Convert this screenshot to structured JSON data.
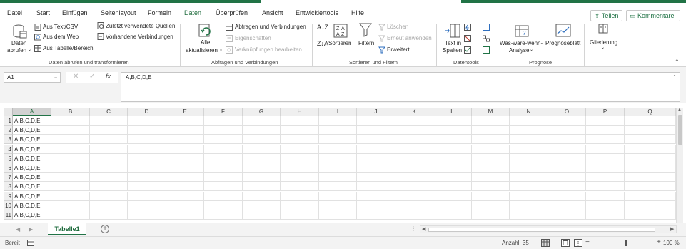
{
  "app": {
    "accent_color": "#217346"
  },
  "tabs": [
    {
      "label": "Datei",
      "active": false
    },
    {
      "label": "Start",
      "active": false
    },
    {
      "label": "Einfügen",
      "active": false
    },
    {
      "label": "Seitenlayout",
      "active": false
    },
    {
      "label": "Formeln",
      "active": false
    },
    {
      "label": "Daten",
      "active": true
    },
    {
      "label": "Überprüfen",
      "active": false
    },
    {
      "label": "Ansicht",
      "active": false
    },
    {
      "label": "Entwicklertools",
      "active": false
    },
    {
      "label": "Hilfe",
      "active": false
    }
  ],
  "actions": {
    "share": "Teilen",
    "comments": "Kommentare"
  },
  "ribbon": {
    "get_data": {
      "data_btn_line1": "Daten",
      "data_btn_line2": "abrufen",
      "from_text": "Aus Text/CSV",
      "from_web": "Aus dem Web",
      "from_table": "Aus Tabelle/Bereich",
      "recent_sources": "Zuletzt verwendete Quellen",
      "existing_connections": "Vorhandene Verbindungen",
      "group_label": "Daten abrufen und transformieren"
    },
    "queries": {
      "refresh_line1": "Alle",
      "refresh_line2": "aktualisieren",
      "queries_connections": "Abfragen und Verbindungen",
      "properties": "Eigenschaften",
      "edit_links": "Verknüpfungen bearbeiten",
      "group_label": "Abfragen und Verbindungen"
    },
    "sort_filter": {
      "sort": "Sortieren",
      "filter": "Filtern",
      "clear": "Löschen",
      "reapply": "Erneut anwenden",
      "advanced": "Erweitert",
      "group_label": "Sortieren und Filtern"
    },
    "data_tools": {
      "text_to_columns_line1": "Text in",
      "text_to_columns_line2": "Spalten",
      "group_label": "Datentools"
    },
    "forecast": {
      "what_if_line1": "Was-wäre-wenn-",
      "what_if_line2": "Analyse",
      "forecast_sheet": "Prognoseblatt",
      "group_label": "Prognose"
    },
    "outline": {
      "label": "Gliederung"
    }
  },
  "formula_bar": {
    "name_box": "A1",
    "fx": "fx",
    "content": "A,B,C,D,E"
  },
  "columns": [
    "A",
    "B",
    "C",
    "D",
    "E",
    "F",
    "G",
    "H",
    "I",
    "J",
    "K",
    "L",
    "M",
    "N",
    "O",
    "P",
    "Q"
  ],
  "rows": [
    {
      "num": "1",
      "a": "A,B,C,D,E"
    },
    {
      "num": "2",
      "a": "A,B,C,D,E"
    },
    {
      "num": "3",
      "a": "A,B,C,D,E"
    },
    {
      "num": "4",
      "a": "A,B,C,D,E"
    },
    {
      "num": "5",
      "a": "A,B,C,D,E"
    },
    {
      "num": "6",
      "a": "A,B,C,D,E"
    },
    {
      "num": "7",
      "a": "A,B,C,D,E"
    },
    {
      "num": "8",
      "a": "A,B,C,D,E"
    },
    {
      "num": "9",
      "a": "A,B,C,D,E"
    },
    {
      "num": "10",
      "a": "A,B,C,D,E"
    },
    {
      "num": "11",
      "a": "A,B,C,D,E"
    }
  ],
  "sheet_tabs": [
    {
      "label": "Tabelle1",
      "active": true
    }
  ],
  "status": {
    "ready": "Bereit",
    "count": "Anzahl: 35",
    "zoom": "100 %"
  }
}
